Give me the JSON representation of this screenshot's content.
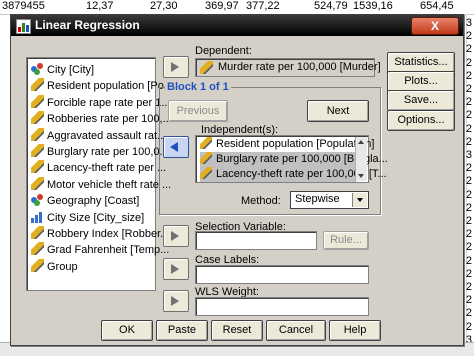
{
  "sheet": {
    "top_row": [
      "3879455",
      "12,37",
      "27,30",
      "369,97",
      "377,22",
      "524,79",
      "1539,16",
      "654,45"
    ],
    "right_column": [
      "3",
      "2",
      "2",
      "2",
      "2",
      "2",
      "2",
      "2",
      "2",
      "2",
      "3",
      "2",
      "2",
      "2",
      "2",
      "2",
      "2",
      "2",
      "2",
      "2",
      "2",
      "2",
      "2",
      "2",
      "3"
    ]
  },
  "dialog": {
    "title": "Linear Regression",
    "close_label": "X",
    "variables": [
      {
        "label": "City [City]",
        "icon": "nominal-icon"
      },
      {
        "label": "Resident population [Po...",
        "icon": "scale-icon"
      },
      {
        "label": "Forcible rape rate per 1...",
        "icon": "scale-icon"
      },
      {
        "label": "Robberies rate per 100,...",
        "icon": "scale-icon"
      },
      {
        "label": "Aggravated assault rat...",
        "icon": "scale-icon"
      },
      {
        "label": "Burglary rate per 100,0...",
        "icon": "scale-icon"
      },
      {
        "label": "Lacency-theft rate per ...",
        "icon": "scale-icon"
      },
      {
        "label": "Motor vehicle theft rate ...",
        "icon": "scale-icon"
      },
      {
        "label": "Geography [Coast]",
        "icon": "nominal-icon"
      },
      {
        "label": "City Size [City_size]",
        "icon": "ordinal-icon"
      },
      {
        "label": "Robbery Index [Robber...",
        "icon": "scale-icon"
      },
      {
        "label": "Grad Fahrenheit [Temp...",
        "icon": "scale-icon"
      },
      {
        "label": "Group",
        "icon": "scale-icon"
      }
    ],
    "dependent_label": "Dependent:",
    "dependent_value": "Murder rate per 100,000 [Murder]",
    "block_label": "Block 1 of 1",
    "previous_label": "Previous",
    "next_label": "Next",
    "independents_label": "Independent(s):",
    "independents": [
      {
        "label": "Resident population [Population]"
      },
      {
        "label": "Burglary rate per 100,000 [Burgla..."
      },
      {
        "label": "Lacency-theft rate per 100,000 [T..."
      }
    ],
    "method_label": "Method:",
    "method_value": "Stepwise",
    "selection_variable_label": "Selection Variable:",
    "rule_label": "Rule...",
    "case_labels_label": "Case Labels:",
    "wls_weight_label": "WLS Weight:",
    "side_buttons": [
      "Statistics...",
      "Plots...",
      "Save...",
      "Options..."
    ],
    "bottom_buttons": [
      "OK",
      "Paste",
      "Reset",
      "Cancel",
      "Help"
    ]
  }
}
